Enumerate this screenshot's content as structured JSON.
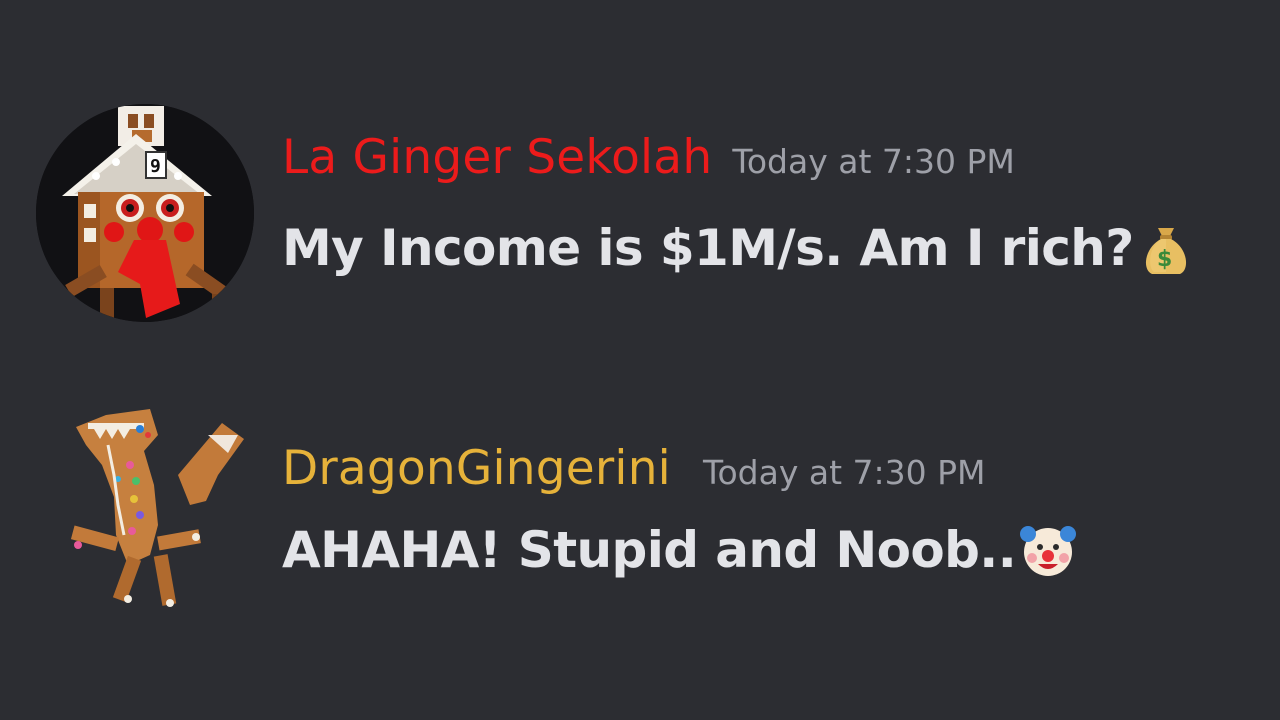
{
  "messages": [
    {
      "username": "La Ginger Sekolah",
      "username_color": "#ec1b1b",
      "timestamp": "Today at 7:30 PM",
      "content": "My Income is $1M/s. Am I rich?",
      "emoji": "money-bag-icon",
      "avatar": "gingerbread-house-avatar"
    },
    {
      "username": "DragonGingerini",
      "username_color": "#e6b23a",
      "timestamp": "Today at 7:30 PM",
      "content": "AHAHA! Stupid and Noob..",
      "emoji": "clown-face-icon",
      "avatar": "gingerbread-dragon-avatar"
    }
  ],
  "colors": {
    "background": "#2c2d32",
    "message_text": "#e3e4e8",
    "timestamp": "#9ea0a8"
  }
}
